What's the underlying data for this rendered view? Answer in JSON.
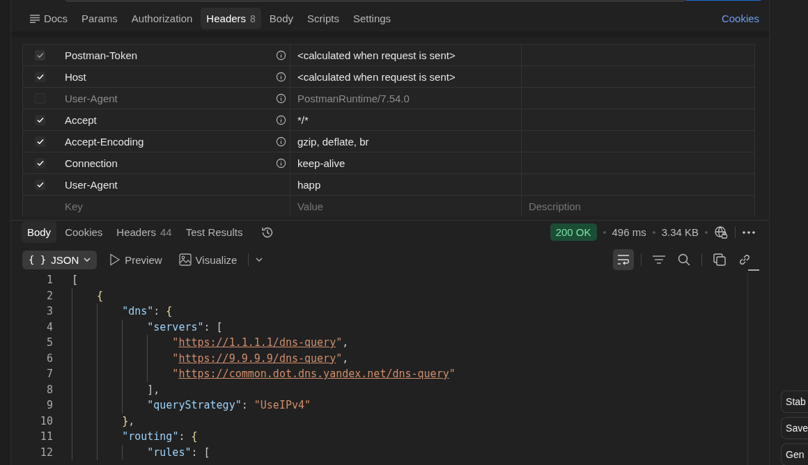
{
  "request_tabs": [
    {
      "label": "Docs",
      "selected": false
    },
    {
      "label": "Params",
      "selected": false
    },
    {
      "label": "Authorization",
      "selected": false
    },
    {
      "label": "Headers",
      "count": "8",
      "selected": true
    },
    {
      "label": "Body",
      "selected": false
    },
    {
      "label": "Scripts",
      "selected": false
    },
    {
      "label": "Settings",
      "selected": false
    }
  ],
  "cookies_link": "Cookies",
  "headers": [
    {
      "key": "Postman-Token",
      "value": "<calculated when request is sent>",
      "checked": true,
      "kind": "locked"
    },
    {
      "key": "Host",
      "value": "<calculated when request is sent>",
      "checked": true,
      "kind": "auto"
    },
    {
      "key": "User-Agent",
      "value": "PostmanRuntime/7.54.0",
      "checked": false,
      "kind": "auto"
    },
    {
      "key": "Accept",
      "value": "*/*",
      "checked": true,
      "kind": "auto"
    },
    {
      "key": "Accept-Encoding",
      "value": "gzip, deflate, br",
      "checked": true,
      "kind": "auto"
    },
    {
      "key": "Connection",
      "value": "keep-alive",
      "checked": true,
      "kind": "auto"
    },
    {
      "key": "User-Agent",
      "value": "happ",
      "checked": true,
      "kind": "custom"
    }
  ],
  "new_header": {
    "key_placeholder": "Key",
    "value_placeholder": "Value",
    "description_placeholder": "Description"
  },
  "response_tabs": [
    {
      "label": "Body",
      "selected": true
    },
    {
      "label": "Cookies",
      "selected": false
    },
    {
      "label": "Headers",
      "count": "44",
      "selected": false
    },
    {
      "label": "Test Results",
      "selected": false
    }
  ],
  "status": {
    "code": "200 OK",
    "time": "496 ms",
    "size": "3.34 KB"
  },
  "format_icon": "{ }",
  "format": "JSON",
  "view_buttons": [
    "Preview",
    "Visualize"
  ],
  "wrap_lines": true,
  "code_lines": [
    {
      "number": "1",
      "tokens": [
        {
          "kind": "punct",
          "text": "["
        }
      ]
    },
    {
      "number": "2",
      "tokens": [
        {
          "kind": "guide"
        },
        {
          "kind": "brace",
          "text": "{"
        }
      ]
    },
    {
      "number": "3",
      "tokens": [
        {
          "kind": "guide"
        },
        {
          "kind": "guide"
        },
        {
          "kind": "key",
          "text": "\"dns\""
        },
        {
          "kind": "punct",
          "text": ": "
        },
        {
          "kind": "brace",
          "text": "{"
        }
      ]
    },
    {
      "number": "4",
      "tokens": [
        {
          "kind": "guide"
        },
        {
          "kind": "guide"
        },
        {
          "kind": "guide"
        },
        {
          "kind": "key",
          "text": "\"servers\""
        },
        {
          "kind": "punct",
          "text": ": ["
        }
      ]
    },
    {
      "number": "5",
      "tokens": [
        {
          "kind": "guide"
        },
        {
          "kind": "guide"
        },
        {
          "kind": "guide"
        },
        {
          "kind": "guide"
        },
        {
          "kind": "string",
          "text": "\""
        },
        {
          "kind": "link",
          "text": "https://1.1.1.1/dns-query"
        },
        {
          "kind": "string",
          "text": "\""
        },
        {
          "kind": "punct",
          "text": ","
        }
      ]
    },
    {
      "number": "6",
      "tokens": [
        {
          "kind": "guide"
        },
        {
          "kind": "guide"
        },
        {
          "kind": "guide"
        },
        {
          "kind": "guide"
        },
        {
          "kind": "string",
          "text": "\""
        },
        {
          "kind": "link",
          "text": "https://9.9.9.9/dns-query"
        },
        {
          "kind": "string",
          "text": "\""
        },
        {
          "kind": "punct",
          "text": ","
        }
      ]
    },
    {
      "number": "7",
      "tokens": [
        {
          "kind": "guide"
        },
        {
          "kind": "guide"
        },
        {
          "kind": "guide"
        },
        {
          "kind": "guide"
        },
        {
          "kind": "string",
          "text": "\""
        },
        {
          "kind": "link",
          "text": "https://common.dot.dns.yandex.net/dns-query"
        },
        {
          "kind": "string",
          "text": "\""
        }
      ]
    },
    {
      "number": "8",
      "tokens": [
        {
          "kind": "guide"
        },
        {
          "kind": "guide"
        },
        {
          "kind": "guide"
        },
        {
          "kind": "punct",
          "text": "],"
        }
      ]
    },
    {
      "number": "9",
      "tokens": [
        {
          "kind": "guide"
        },
        {
          "kind": "guide"
        },
        {
          "kind": "guide"
        },
        {
          "kind": "key",
          "text": "\"queryStrategy\""
        },
        {
          "kind": "punct",
          "text": ": "
        },
        {
          "kind": "string",
          "text": "\"UseIPv4\""
        }
      ]
    },
    {
      "number": "10",
      "tokens": [
        {
          "kind": "guide"
        },
        {
          "kind": "guide"
        },
        {
          "kind": "brace",
          "text": "}"
        },
        {
          "kind": "punct",
          "text": ","
        }
      ]
    },
    {
      "number": "11",
      "tokens": [
        {
          "kind": "guide"
        },
        {
          "kind": "guide"
        },
        {
          "kind": "key",
          "text": "\"routing\""
        },
        {
          "kind": "punct",
          "text": ": "
        },
        {
          "kind": "brace",
          "text": "{"
        }
      ]
    },
    {
      "number": "12",
      "tokens": [
        {
          "kind": "guide"
        },
        {
          "kind": "guide"
        },
        {
          "kind": "guide"
        },
        {
          "kind": "key",
          "text": "\"rules\""
        },
        {
          "kind": "punct",
          "text": ": ["
        }
      ]
    }
  ],
  "side_buttons": [
    "Stab",
    "Save",
    "Gen"
  ]
}
